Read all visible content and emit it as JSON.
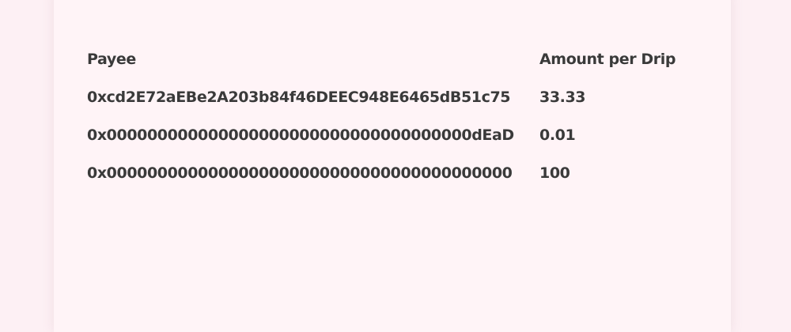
{
  "table": {
    "headers": {
      "payee": "Payee",
      "amount": "Amount per Drip"
    },
    "rows": [
      {
        "payee": "0xcd2E72aEBe2A203b84f46DEEC948E6465dB51c75",
        "amount": "33.33"
      },
      {
        "payee": "0x000000000000000000000000000000000000dEaD",
        "amount": "0.01"
      },
      {
        "payee": "0x0000000000000000000000000000000000000000",
        "amount": "100"
      }
    ]
  }
}
